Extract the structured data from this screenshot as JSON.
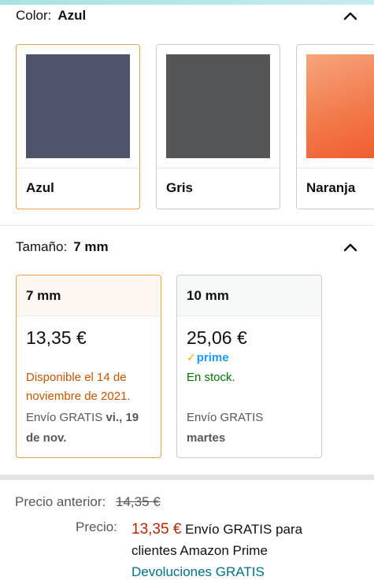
{
  "color_section": {
    "label": "Color:",
    "selected": "Azul",
    "swatches": [
      {
        "name": "Azul",
        "color": "#4f546b",
        "selected": true
      },
      {
        "name": "Gris",
        "color": "#545658",
        "selected": false
      },
      {
        "name": "Naranja",
        "color": "#f2794a",
        "selected": false
      }
    ]
  },
  "size_section": {
    "label": "Tamaño:",
    "selected": "7 mm",
    "options": [
      {
        "size": "7 mm",
        "price": "13,35 €",
        "availability": "Disponible el 14 de noviembre de 2021.",
        "availability_line1": "Disponible el 14 de",
        "availability_line2": "noviembre de 2021.",
        "shipping_prefix": "Envío GRATIS",
        "shipping_bold_1": "vi., 19",
        "shipping_bold_2": "de nov.",
        "selected": true
      },
      {
        "size": "10 mm",
        "price": "25,06 €",
        "prime": "prime",
        "availability": "En stock.",
        "shipping_prefix": "Envío GRATIS",
        "shipping_bold": "martes",
        "selected": false
      }
    ]
  },
  "pricing": {
    "previous_label": "Precio anterior:",
    "previous_value": "14,35 €",
    "price_label": "Precio:",
    "price_value": "13,35 €",
    "shipping_line1": "Envío GRATIS para",
    "shipping_line2": "clientes Amazon Prime",
    "returns": "Devoluciones GRATIS"
  },
  "colors": {
    "accent_border": "#e3a54a",
    "price_red": "#b12704",
    "availability_orange": "#c45500",
    "in_stock_green": "#007600",
    "link_teal": "#007185",
    "prime_blue": "#1a98ff"
  }
}
